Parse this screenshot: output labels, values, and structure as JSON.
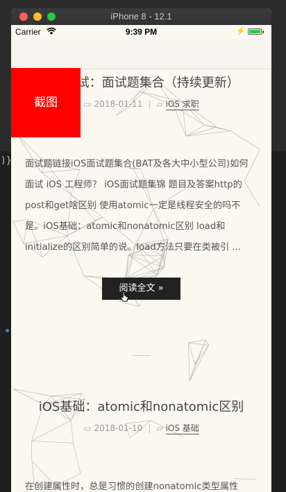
{
  "window": {
    "title": "iPhone 8 - 12.1"
  },
  "statusbar": {
    "carrier": "Carrier",
    "time": "9:39 PM",
    "battery_level": 1.0
  },
  "overlay": {
    "screenshot_label": "截图"
  },
  "post1": {
    "title": "iOS面试：面试题集合（持续更新）",
    "date": "2018-01-11",
    "category": "iOS 求职",
    "excerpt": "面试题链接iOS面试题集合(BAT及各大中小型公司)如何面试 iOS 工程师？ iOS面试题集锦 题目及答案http的post和get啥区别 使用atomic一定是线程安全的吗不是。iOS基础：atomic和nonatomic区别 load和initialize的区别简单的说。load方法只要在类被引 ...",
    "read_more": "阅读全文 »"
  },
  "post2": {
    "title": "iOS基础：atomic和nonatomic区别",
    "date": "2018-01-10",
    "category": "iOS 基础",
    "excerpt": "在创建属性时，总是习惯的创建nonatomic类型属性"
  },
  "behind_window": {
    "left_text": ")}"
  },
  "icons": {
    "calendar": "calendar-icon",
    "folder": "folder-icon",
    "wifi": "wifi-icon",
    "pointer": "pointer-cursor-icon"
  },
  "colors": {
    "screenshot_button": "#ff0000",
    "read_more_bg": "#222222",
    "page_bg": "#faf8ef"
  }
}
